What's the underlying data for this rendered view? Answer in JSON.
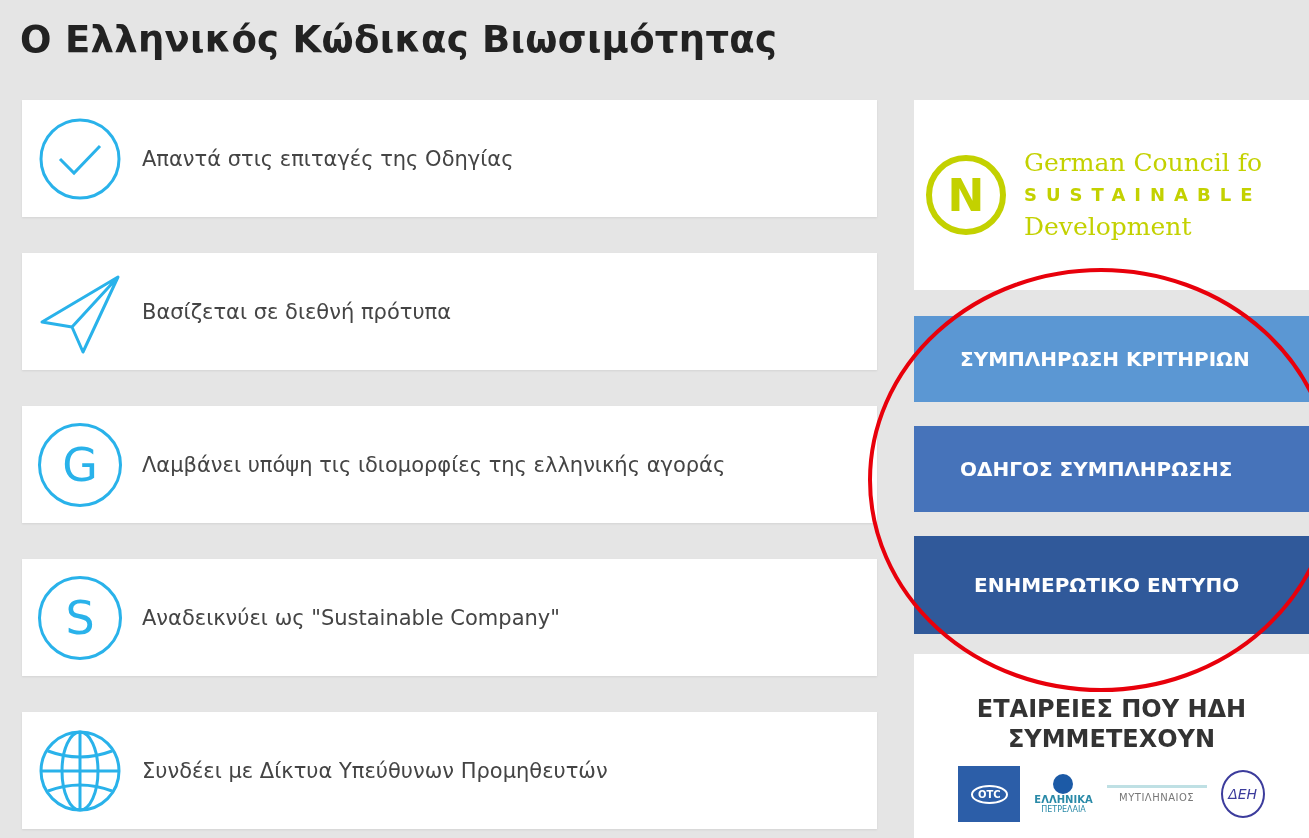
{
  "title": "Ο Ελληνικός Κώδικας Βιωσιμότητας",
  "features": [
    {
      "kind": "check",
      "text": "Απαντά στις επιταγές της Οδηγίας"
    },
    {
      "kind": "plane",
      "text": "Βασίζεται σε διεθνή πρότυπα"
    },
    {
      "kind": "letter",
      "icon_text": "G",
      "text": "Λαμβάνει υπόψη τις ιδιομορφίες της ελληνικής αγοράς"
    },
    {
      "kind": "letter",
      "icon_text": "S",
      "text": "Αναδεικνύει ως \"Sustainable Company\""
    },
    {
      "kind": "globe",
      "text": "Συνδέει με Δίκτυα Υπεύθυνων Προμηθευτών"
    }
  ],
  "council_logo": {
    "letter": "N",
    "line_1": "German Council fo",
    "line_2": "SUSTAINABLE",
    "line_3": "Development"
  },
  "buttons": [
    {
      "label": "ΣΥΜΠΛΗΡΩΣΗ ΚΡΙΤΗΡΙΩΝ",
      "color": "#5b97d3"
    },
    {
      "label": "ΟΔΗΓΟΣ ΣΥΜΠΛΗΡΩΣΗΣ",
      "color": "#4673ba"
    },
    {
      "label": "ΕΝΗΜΕΡΩΤΙΚΟ ΕΝΤΥΠΟ",
      "color": "#30599a"
    }
  ],
  "companies": {
    "heading": "ΕΤΑΙΡΕΙΕΣ ΠΟΥ ΗΔΗ ΣΥΜΜΕΤΕΧΟΥΝ",
    "logos": [
      {
        "kind": "box",
        "texts": [
          "OTC"
        ]
      },
      {
        "kind": "drop",
        "texts": [
          "ΕΛΛΗΝΙΚΑ",
          "ΠΕΤΡΕΛΑΙΑ"
        ]
      },
      {
        "kind": "plain",
        "texts": [
          "ΜΥΤΙΛΗΝΑΙΟΣ"
        ]
      },
      {
        "kind": "ring",
        "texts": [
          "ΔΕΗ"
        ]
      }
    ]
  },
  "annotation": {
    "kind": "circle"
  }
}
